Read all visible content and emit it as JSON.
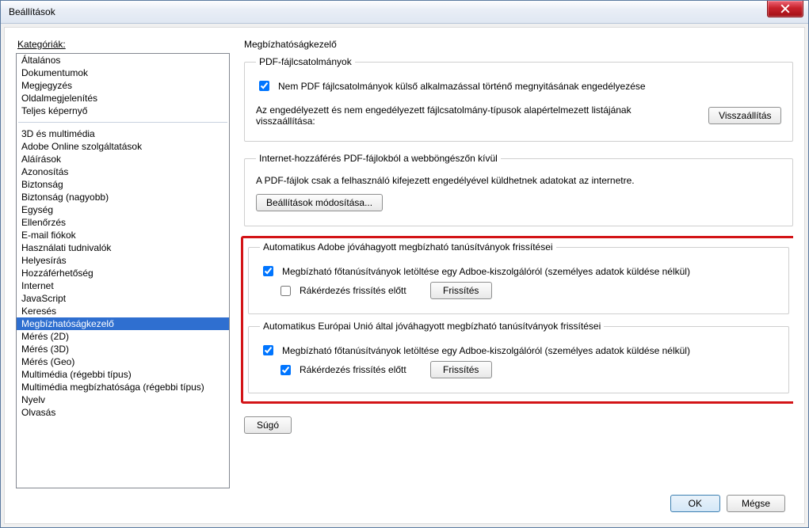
{
  "window": {
    "title": "Beállítások"
  },
  "categories": {
    "label": "Kategóriák:",
    "groups": [
      [
        "Általános",
        "Dokumentumok",
        "Megjegyzés",
        "Oldalmegjelenítés",
        "Teljes képernyő"
      ],
      [
        "3D és multimédia",
        "Adobe Online szolgáltatások",
        "Aláírások",
        "Azonosítás",
        "Biztonság",
        "Biztonság (nagyobb)",
        "Egység",
        "Ellenőrzés",
        "E-mail fiókok",
        "Használati tudnivalók",
        "Helyesírás",
        "Hozzáférhetőség",
        "Internet",
        "JavaScript",
        "Keresés",
        "Megbízhatóságkezelő",
        "Mérés (2D)",
        "Mérés (3D)",
        "Mérés (Geo)",
        "Multimédia (régebbi típus)",
        "Multimédia megbízhatósága (régebbi típus)",
        "Nyelv",
        "Olvasás"
      ]
    ],
    "selected": "Megbízhatóságkezelő"
  },
  "panel": {
    "title": "Megbízhatóságkezelő",
    "attachments": {
      "legend": "PDF-fájlcsatolmányok",
      "allow_open_external": {
        "checked": true,
        "label": "Nem PDF fájlcsatolmányok külső alkalmazással történő megnyitásának engedélyezése"
      },
      "reset_text": "Az engedélyezett és nem engedélyezett fájlcsatolmány-típusok alapértelmezett listájának visszaállítása:",
      "reset_button": "Visszaállítás"
    },
    "internet": {
      "legend": "Internet-hozzáférés PDF-fájlokból a webböngészőn kívül",
      "desc": "A PDF-fájlok csak a felhasználó kifejezett engedélyével küldhetnek adatokat az internetre.",
      "settings_button": "Beállítások módosítása..."
    },
    "adobe_trust": {
      "legend": "Automatikus Adobe jóváhagyott megbízható tanúsítványok frissítései",
      "download": {
        "checked": true,
        "label": "Megbízható főtanúsítványok letöltése egy Adboe-kiszolgálóról (személyes adatok küldése nélkül)"
      },
      "ask": {
        "checked": false,
        "label": "Rákérdezés frissítés előtt"
      },
      "update_button": "Frissítés"
    },
    "eu_trust": {
      "legend": "Automatikus Európai Unió által jóváhagyott megbízható tanúsítványok frissítései",
      "download": {
        "checked": true,
        "label": "Megbízható főtanúsítványok letöltése egy Adboe-kiszolgálóról (személyes adatok küldése nélkül)"
      },
      "ask": {
        "checked": true,
        "label": "Rákérdezés frissítés előtt"
      },
      "update_button": "Frissítés"
    },
    "help_button": "Súgó"
  },
  "footer": {
    "ok": "OK",
    "cancel": "Mégse"
  }
}
